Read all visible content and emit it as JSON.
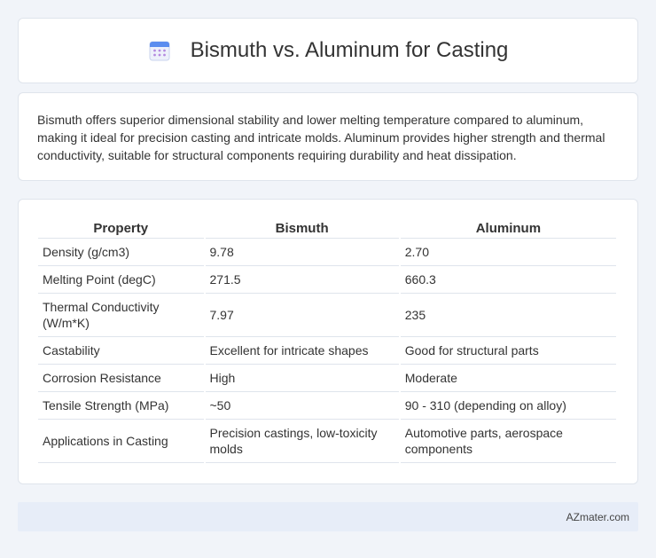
{
  "header": {
    "title": "Bismuth vs. Aluminum for Casting",
    "icon": "calendar-icon"
  },
  "summary": {
    "text": "Bismuth offers superior dimensional stability and lower melting temperature compared to aluminum, making it ideal for precision casting and intricate molds. Aluminum provides higher strength and thermal conductivity, suitable for structural components requiring durability and heat dissipation."
  },
  "table": {
    "headers": [
      "Property",
      "Bismuth",
      "Aluminum"
    ],
    "rows": [
      [
        "Density (g/cm3)",
        "9.78",
        "2.70"
      ],
      [
        "Melting Point (degC)",
        "271.5",
        "660.3"
      ],
      [
        "Thermal Conductivity (W/m*K)",
        "7.97",
        "235"
      ],
      [
        "Castability",
        "Excellent for intricate shapes",
        "Good for structural parts"
      ],
      [
        "Corrosion Resistance",
        "High",
        "Moderate"
      ],
      [
        "Tensile Strength (MPa)",
        "~50",
        "90 - 310 (depending on alloy)"
      ],
      [
        "Applications in Casting",
        "Precision castings, low-toxicity molds",
        "Automotive parts, aerospace components"
      ]
    ]
  },
  "footer": {
    "brand": "AZmater.com"
  },
  "colors": {
    "accent": "#5b8def",
    "background": "#f1f4f9",
    "footer_bg": "#e7edf8"
  }
}
